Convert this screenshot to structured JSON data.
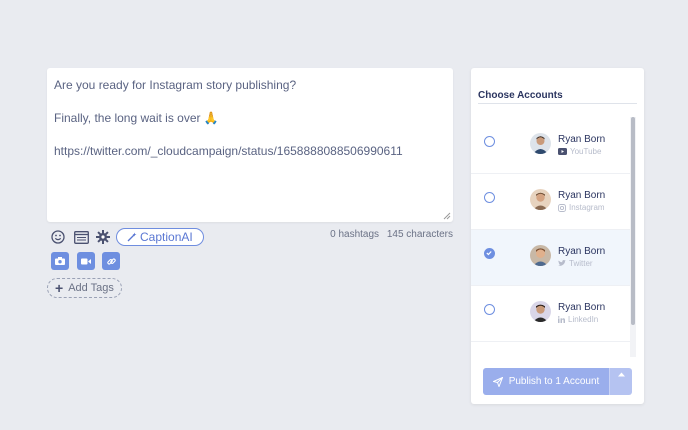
{
  "composer": {
    "line1": "Are you ready for Instagram story publishing?",
    "line2": "Finally, the long wait is over 🙏",
    "line3": "https://twitter.com/_cloudcampaign/status/1658888088506990611"
  },
  "tools": {
    "caption_label": "CaptionAI",
    "hashtags": "0 hashtags",
    "characters": "145 characters"
  },
  "tags": {
    "add_label": "Add Tags"
  },
  "accounts": {
    "title": "Choose Accounts",
    "items": [
      {
        "name": "Ryan Born",
        "network": "YouTube",
        "selected": false
      },
      {
        "name": "Ryan Born",
        "network": "Instagram",
        "selected": false
      },
      {
        "name": "Ryan Born",
        "network": "Twitter",
        "selected": true
      },
      {
        "name": "Ryan Born",
        "network": "LinkedIn",
        "selected": false
      }
    ],
    "publish_label": "Publish to 1 Account"
  },
  "colors": {
    "accent": "#6e8fe0",
    "publish": "#9aaeec"
  }
}
